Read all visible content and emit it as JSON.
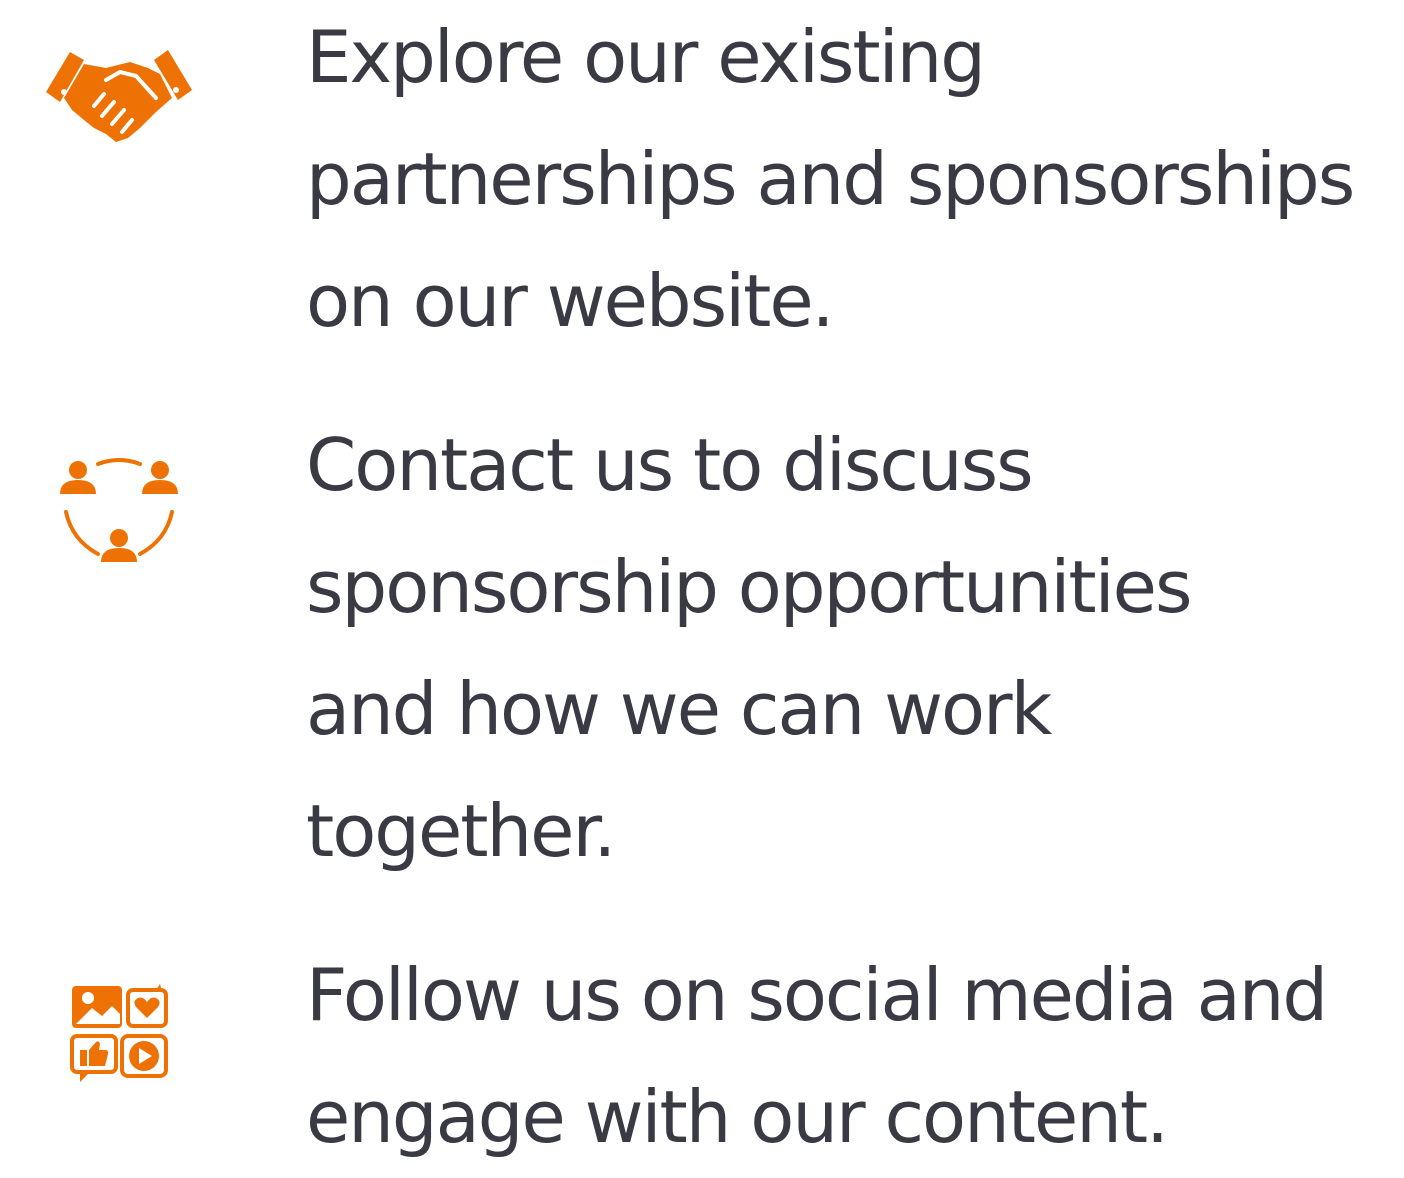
{
  "items": [
    {
      "icon": "handshake-icon",
      "text": "Explore our existing partnerships and sponsorships on our website."
    },
    {
      "icon": "team-network-icon",
      "text": "Contact us to discuss sponsorship opportunities and how we can work together."
    },
    {
      "icon": "social-media-icon",
      "text": "Follow us on social media and engage with our content."
    }
  ],
  "colors": {
    "accent": "#EE7203",
    "text": "#3A3A44",
    "background": "#FFFFFF"
  }
}
